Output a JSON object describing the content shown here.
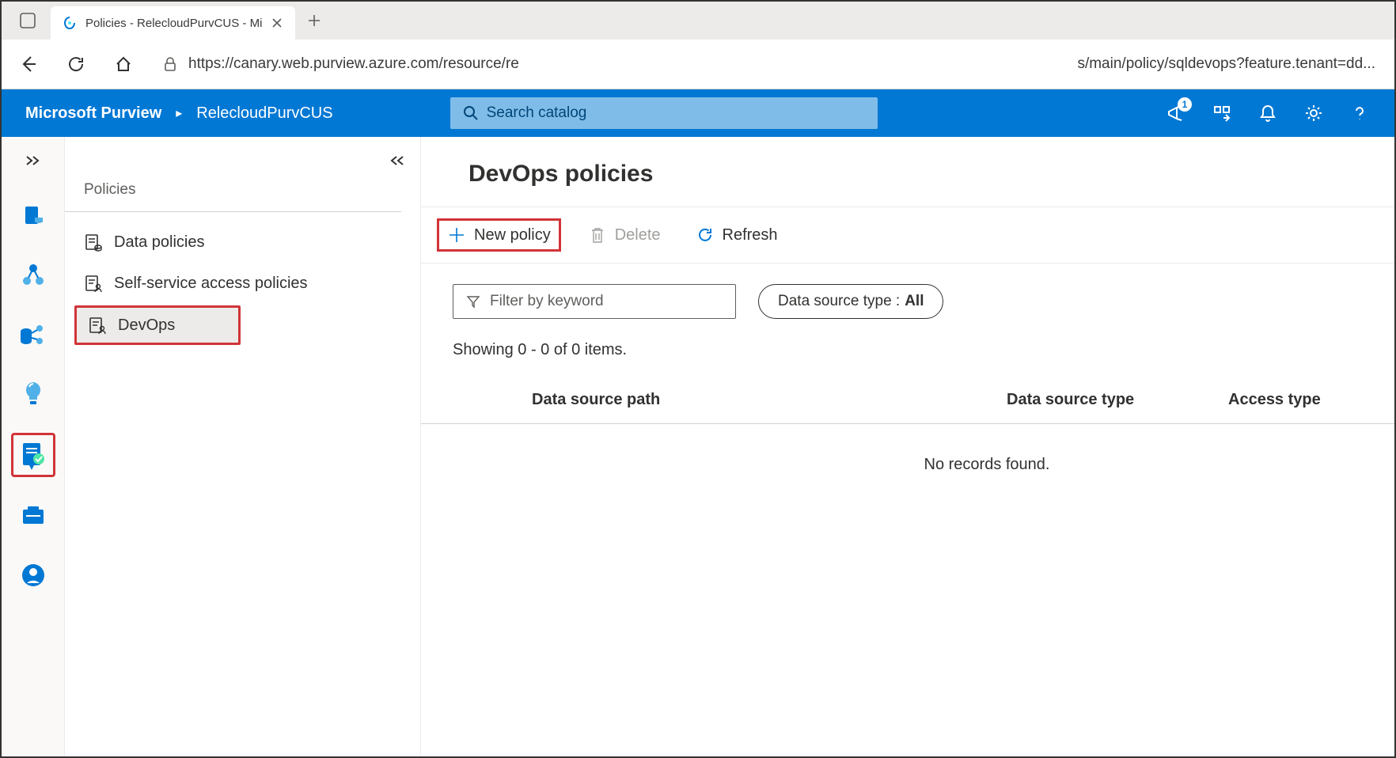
{
  "browser": {
    "tab_title": "Policies - RelecloudPurvCUS - Mi",
    "url_left": "https://canary.web.purview.azure.com/resource/re",
    "url_right": "s/main/policy/sqldevops?feature.tenant=dd..."
  },
  "header": {
    "brand": "Microsoft Purview",
    "breadcrumb": "RelecloudPurvCUS",
    "search_placeholder": "Search catalog",
    "notification_count": "1"
  },
  "sidenav": {
    "title": "Policies",
    "items": [
      {
        "label": "Data policies"
      },
      {
        "label": "Self-service access policies"
      },
      {
        "label": "DevOps"
      }
    ]
  },
  "content": {
    "page_title": "DevOps policies",
    "toolbar": {
      "new_label": "New policy",
      "delete_label": "Delete",
      "refresh_label": "Refresh"
    },
    "filter_placeholder": "Filter by keyword",
    "source_type_label": "Data source type :",
    "source_type_value": "All",
    "count_text": "Showing 0 - 0 of 0 items.",
    "columns": {
      "path": "Data source path",
      "type": "Data source type",
      "access": "Access type"
    },
    "empty_text": "No records found."
  }
}
